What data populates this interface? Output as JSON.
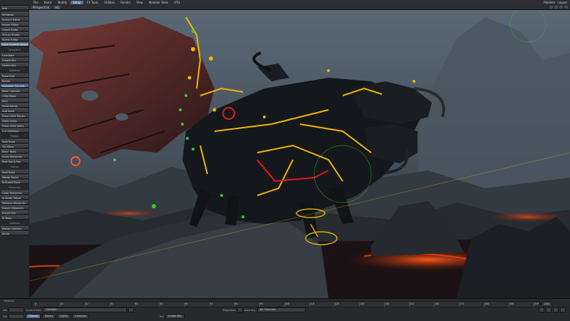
{
  "app": {
    "topbar_left": "File",
    "menu": [
      "Items",
      "Modify",
      "Setup",
      "FX Tools",
      "Utilities",
      "Render",
      "View",
      "Modeler Tools",
      "UTIL"
    ],
    "active_menu": "Setup",
    "topbar_right": [
      "Modeler",
      "Layout"
    ]
  },
  "viewbar": {
    "view_mode": "Perspective",
    "zoom": "HD"
  },
  "sidebar": {
    "groups": [
      {
        "head": "",
        "items": [
          "Edit",
          "Add"
        ]
      },
      {
        "head": "",
        "items": [
          "Windows",
          "Surface Editor",
          "Image Editor",
          "Graph Editor",
          "Virtual Studio",
          "Scene Editor",
          "Save Current Object"
        ]
      },
      {
        "head": "Selection",
        "items": [
          "Calculate",
          "Create Key",
          "Delete Key"
        ]
      },
      {
        "head": "Skeleton",
        "items": [
          "Bone Edit",
          "Bones",
          "Skelegon Convert",
          "Bone Controls",
          "Child Bone",
          "Joint",
          "Draw Bones",
          "Add Bone",
          "Draw Child Bones",
          "Draw Joints",
          "Draw Child Joints",
          "Cut Skelegon"
        ]
      },
      {
        "head": "Modify",
        "items": [
          "Split Bone",
          "Tip Move",
          "Bone Twist",
          "Scale Hierarchy",
          "Rest Rot & Pos"
        ]
      },
      {
        "head": "Detail",
        "items": [
          "Split Bone",
          "Merge Bones",
          "IK/Fused Bone"
        ]
      },
      {
        "head": "Hierarchy",
        "items": [
          "Color Hierarchy",
          "Ik Motor Setup",
          "Remove Hierarchy",
          "Export Hierarchy",
          "Import Rig",
          "Ik Tools"
        ]
      },
      {
        "head": "Motions",
        "items": [
          "Motion Options",
          "Joints"
        ]
      }
    ],
    "highlighted": "Save Current Object",
    "selected": "Skelegon Convert"
  },
  "timeline": {
    "position_label": "Position",
    "ticks": [
      "0",
      "10",
      "20",
      "30",
      "40",
      "50",
      "60",
      "70",
      "80",
      "90",
      "100",
      "110",
      "120",
      "130",
      "140",
      "150",
      "160",
      "170",
      "180",
      "190",
      "200"
    ],
    "current_frame": "0",
    "end_frame": "200",
    "right_ticks": [
      "200",
      "212"
    ]
  },
  "controls": {
    "row1": {
      "x_label": "Dis",
      "current_item_label": "Current Item",
      "current_item_value": "Cheetah",
      "properties_label": "Properties",
      "auto_key_label": "Auto Key",
      "auto_key_value": "All Channels"
    },
    "row2": {
      "y_label": "Dis",
      "objects_label": "Objects",
      "bones_label": "Bones",
      "lights_label": "Lights",
      "cameras_label": "Cameras",
      "sel_label": "Sel",
      "create_key_label": "Create Key"
    }
  },
  "colors": {
    "accent": "#6a86b0",
    "rig_yellow": "#f0b400",
    "rig_green": "#3acb2c",
    "rig_red": "#e01b1b",
    "lava": "#ff3a10"
  }
}
